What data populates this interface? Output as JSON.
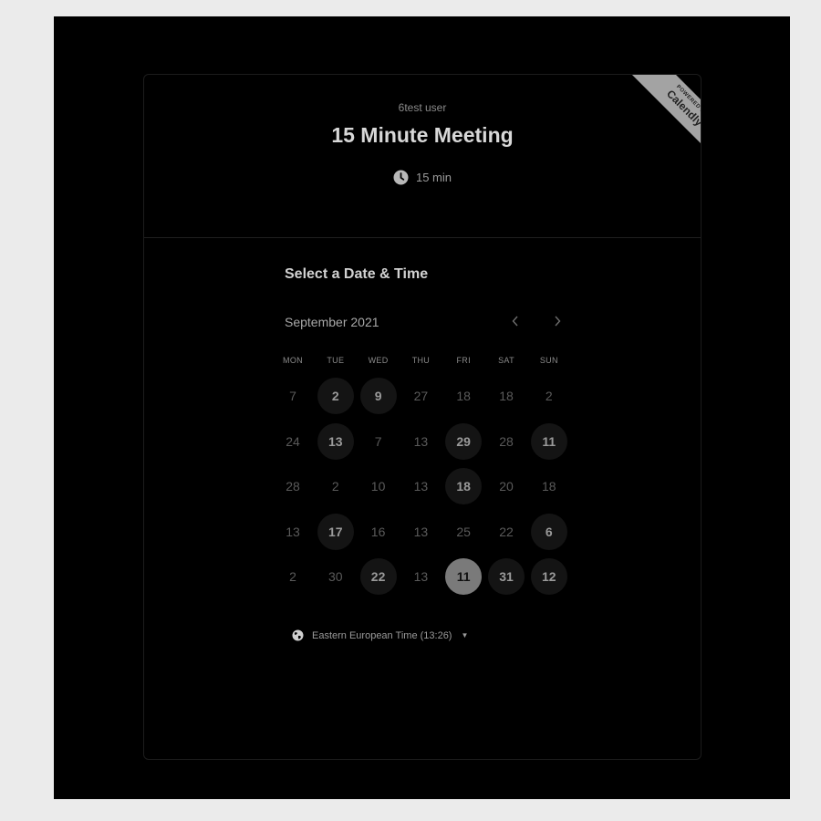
{
  "header": {
    "owner": "6test user",
    "title": "15 Minute Meeting",
    "duration": "15 min"
  },
  "badge": {
    "line1": "POWERED BY",
    "line2": "Calendly"
  },
  "scheduler": {
    "heading": "Select a Date & Time",
    "month": "September 2021",
    "weekdays": [
      "MON",
      "TUE",
      "WED",
      "THU",
      "FRI",
      "SAT",
      "SUN"
    ],
    "weeks": [
      [
        {
          "d": "7",
          "s": "off"
        },
        {
          "d": "2",
          "s": "avail"
        },
        {
          "d": "9",
          "s": "avail"
        },
        {
          "d": "27",
          "s": "off"
        },
        {
          "d": "18",
          "s": "off"
        },
        {
          "d": "18",
          "s": "off"
        },
        {
          "d": "2",
          "s": "off"
        }
      ],
      [
        {
          "d": "24",
          "s": "off"
        },
        {
          "d": "13",
          "s": "avail"
        },
        {
          "d": "7",
          "s": "off"
        },
        {
          "d": "13",
          "s": "off"
        },
        {
          "d": "29",
          "s": "avail"
        },
        {
          "d": "28",
          "s": "off"
        },
        {
          "d": "11",
          "s": "avail"
        }
      ],
      [
        {
          "d": "28",
          "s": "off"
        },
        {
          "d": "2",
          "s": "off"
        },
        {
          "d": "10",
          "s": "off"
        },
        {
          "d": "13",
          "s": "off"
        },
        {
          "d": "18",
          "s": "avail"
        },
        {
          "d": "20",
          "s": "off"
        },
        {
          "d": "18",
          "s": "off"
        }
      ],
      [
        {
          "d": "13",
          "s": "off"
        },
        {
          "d": "17",
          "s": "avail"
        },
        {
          "d": "16",
          "s": "off"
        },
        {
          "d": "13",
          "s": "off"
        },
        {
          "d": "25",
          "s": "off"
        },
        {
          "d": "22",
          "s": "off"
        },
        {
          "d": "6",
          "s": "avail"
        }
      ],
      [
        {
          "d": "2",
          "s": "off"
        },
        {
          "d": "30",
          "s": "off"
        },
        {
          "d": "22",
          "s": "avail"
        },
        {
          "d": "13",
          "s": "off"
        },
        {
          "d": "11",
          "s": "selected"
        },
        {
          "d": "31",
          "s": "avail"
        },
        {
          "d": "12",
          "s": "avail"
        }
      ]
    ],
    "timezone": "Eastern European Time (13:26)"
  },
  "colors": {
    "background": "#000000",
    "selected_day": "#7a7a7a",
    "available_day": "#141414",
    "badge": "#a3a3a3"
  },
  "icons": {
    "duration": "clock-icon",
    "timezone": "globe-icon",
    "prev": "chevron-left-icon",
    "next": "chevron-right-icon"
  }
}
